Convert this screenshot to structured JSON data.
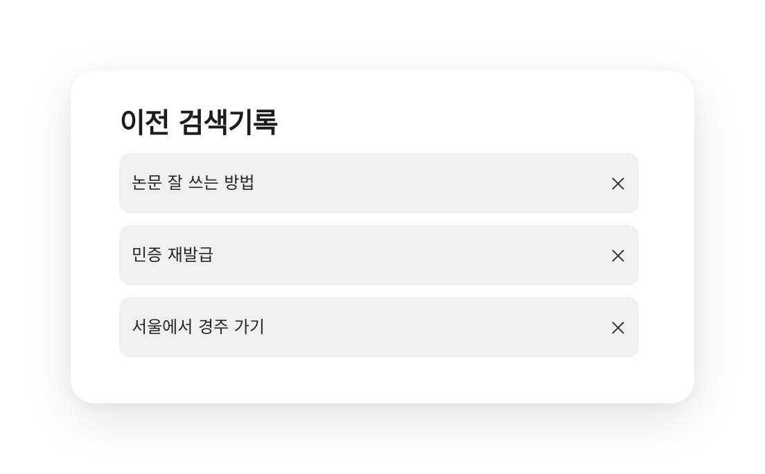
{
  "panel": {
    "title": "이전 검색기록",
    "items": [
      {
        "label": "논문 잘 쓰는 방법",
        "remove_icon": "close-icon"
      },
      {
        "label": "민증 재발급",
        "remove_icon": "close-icon"
      },
      {
        "label": "서울에서 경주 가기",
        "remove_icon": "close-icon"
      }
    ]
  }
}
